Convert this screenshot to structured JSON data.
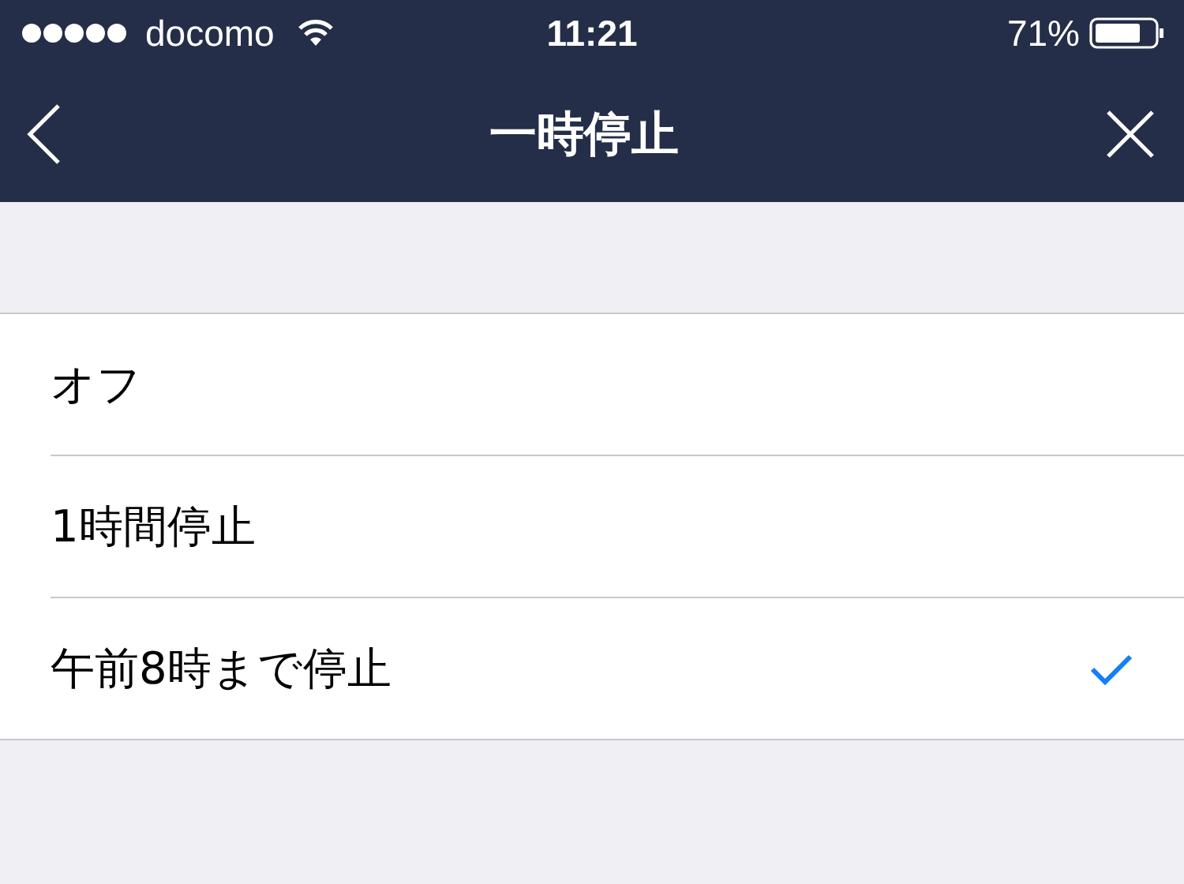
{
  "status_bar": {
    "carrier": "docomo",
    "time": "11:21",
    "battery": "71%"
  },
  "nav_bar": {
    "title": "一時停止"
  },
  "options": [
    {
      "label": "オフ",
      "selected": false
    },
    {
      "label": "1時間停止",
      "selected": false
    },
    {
      "label": "午前8時まで停止",
      "selected": true
    }
  ]
}
